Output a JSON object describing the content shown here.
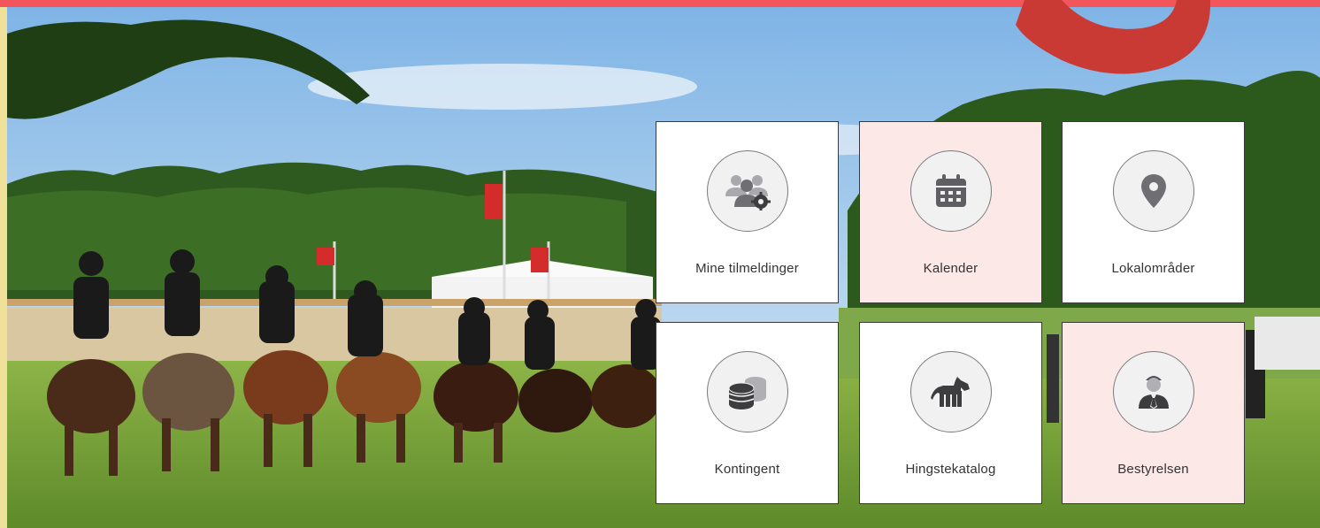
{
  "colors": {
    "top_bar": "#f2565a",
    "logo_red": "#c93a35",
    "tile_white": "#ffffff",
    "tile_pink": "#fde8e8",
    "icon_gray": "#6f6f73"
  },
  "tiles": [
    {
      "label": "Mine tilmeldinger",
      "icon": "users-gear-icon",
      "variant": "white"
    },
    {
      "label": "Kalender",
      "icon": "calendar-icon",
      "variant": "pink"
    },
    {
      "label": "Lokalområder",
      "icon": "map-pin-icon",
      "variant": "white"
    },
    {
      "label": "Kontingent",
      "icon": "coins-icon",
      "variant": "white"
    },
    {
      "label": "Hingstekatalog",
      "icon": "horse-icon",
      "variant": "white"
    },
    {
      "label": "Bestyrelsen",
      "icon": "person-tie-icon",
      "variant": "pink"
    }
  ]
}
